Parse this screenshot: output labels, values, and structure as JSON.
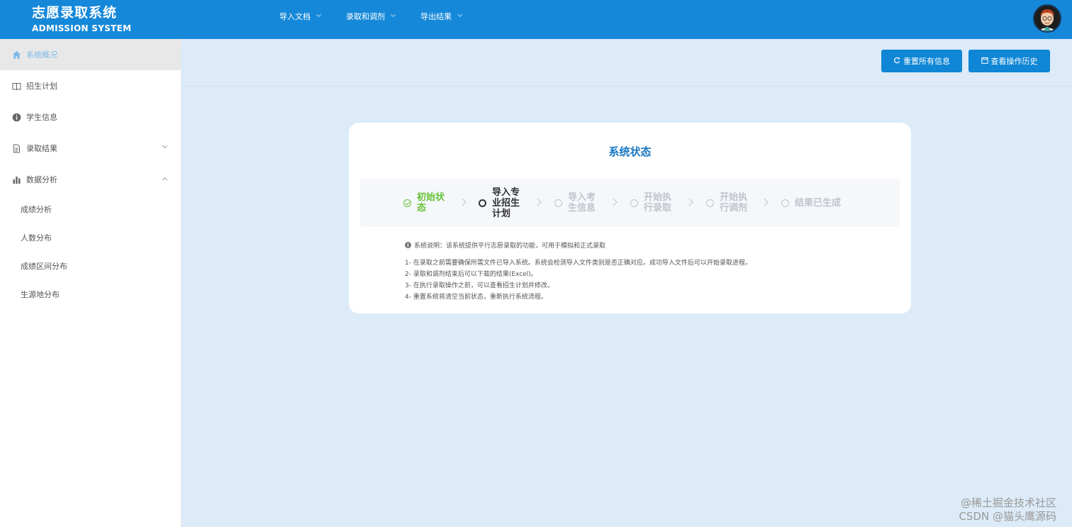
{
  "header": {
    "brand_title": "志愿录取系统",
    "brand_subtitle": "ADMISSION SYSTEM",
    "nav": [
      {
        "label": "导入文档"
      },
      {
        "label": "录取和调剂"
      },
      {
        "label": "导出结果"
      }
    ],
    "bg_color": "#1588d9"
  },
  "sidebar": {
    "items": [
      {
        "label": "系统概况",
        "icon": "home-icon",
        "active": true
      },
      {
        "label": "招生计划",
        "icon": "book-icon"
      },
      {
        "label": "学生信息",
        "icon": "info-icon"
      },
      {
        "label": "录取结果",
        "icon": "document-icon",
        "expand": "chevron-down-icon"
      },
      {
        "label": "数据分析",
        "icon": "bar-chart-icon",
        "expand": "chevron-up-icon"
      }
    ],
    "subitems": [
      {
        "label": "成绩分析"
      },
      {
        "label": "人数分布"
      },
      {
        "label": "成绩区间分布"
      },
      {
        "label": "生源地分布"
      }
    ]
  },
  "toolbar": {
    "reset_label": "重置所有信息",
    "history_label": "查看操作历史"
  },
  "card": {
    "title": "系统状态",
    "steps": [
      {
        "label": "初始状态",
        "status": "done"
      },
      {
        "label": "导入专业招生计划",
        "status": "current"
      },
      {
        "label": "导入考生信息",
        "status": "wait"
      },
      {
        "label": "开始执行录取",
        "status": "wait"
      },
      {
        "label": "开始执行调剂",
        "status": "wait"
      },
      {
        "label": "结果已生成",
        "status": "wait"
      }
    ],
    "description_title": "系统说明：该系统提供平行志愿录取的功能，可用于模拟和正式录取",
    "description_lines": [
      "1- 在录取之前需要确保所需文件已导入系统。系统会检测导入文件类别是否正确对应。成功导入文件后可以开始录取进程。",
      "2- 录取和调剂结束后可以下载的结果(Excel)。",
      "3- 在执行录取操作之前，可以查看招生计划并修改。",
      "4- 重置系统将清空当前状态，重新执行系统流程。"
    ]
  },
  "watermark": {
    "line1": "@稀土掘金技术社区",
    "line2": "CSDN @猫头鹰源码"
  },
  "colors": {
    "accent": "#0f86d6",
    "success": "#67c23a",
    "page_bg": "#dcebf7"
  }
}
